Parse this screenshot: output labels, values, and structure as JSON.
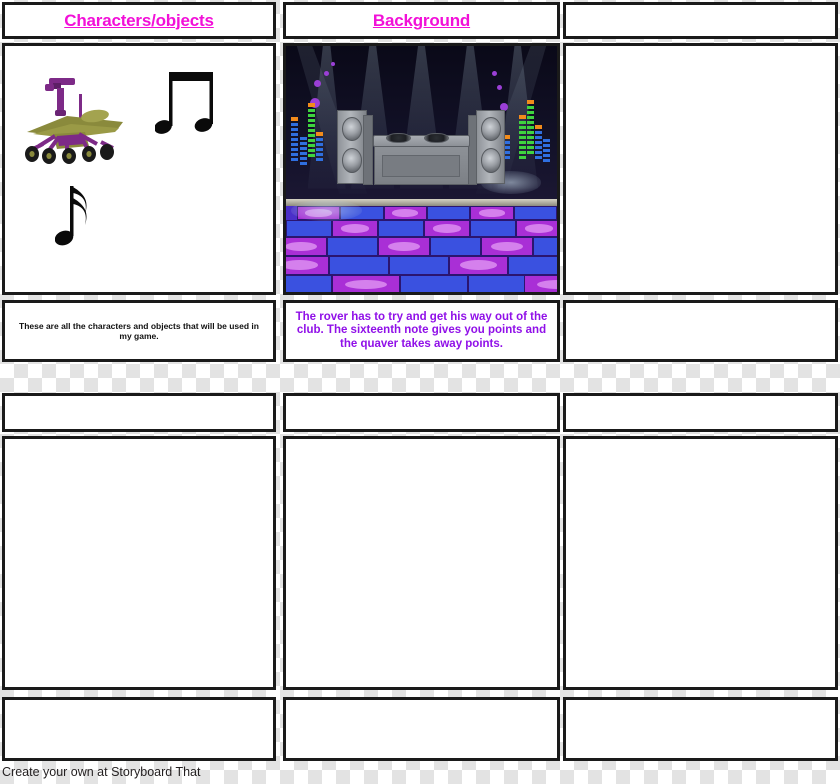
{
  "footer": {
    "text": "Create your own at Storyboard That"
  },
  "board": {
    "columns": 3,
    "rows": 2,
    "cells": [
      {
        "id": "r1c1",
        "title": "Characters/objects",
        "title_color": "#f210d8",
        "caption": "These are all the characters and objects that will be used in my game.",
        "caption_color": "#111111",
        "artwork": "characters-objects-scene",
        "has_art": true
      },
      {
        "id": "r1c2",
        "title": "Background",
        "title_color": "#f210d8",
        "caption": "The rover has to try and get his way out of the club. The sixteenth note gives you points and the quaver takes away points.",
        "caption_color": "#9010e8",
        "artwork": "nightclub-dancefloor-scene",
        "has_art": true
      },
      {
        "id": "r1c3",
        "title": "",
        "title_color": "#f210d8",
        "caption": "",
        "caption_color": "#111111",
        "artwork": "",
        "has_art": false
      },
      {
        "id": "r2c1",
        "title": "",
        "title_color": "#f210d8",
        "caption": "",
        "caption_color": "#111111",
        "artwork": "",
        "has_art": false
      },
      {
        "id": "r2c2",
        "title": "",
        "title_color": "#f210d8",
        "caption": "",
        "caption_color": "#111111",
        "artwork": "",
        "has_art": false
      },
      {
        "id": "r2c3",
        "title": "",
        "title_color": "#f210d8",
        "caption": "",
        "caption_color": "#111111",
        "artwork": "",
        "has_art": false
      }
    ]
  },
  "artwork": {
    "characters_objects": {
      "items": [
        {
          "name": "mars-rover",
          "colors": {
            "panel": "#8a8a3c",
            "body": "#7d2a87",
            "wheel": "#1a1a1a"
          }
        },
        {
          "name": "beamed-eighth-notes",
          "color": "#0a0a0a"
        },
        {
          "name": "sixteenth-note",
          "color": "#0a0a0a"
        }
      ]
    },
    "nightclub": {
      "elements": [
        "stage-lights",
        "equalizer-bars-left",
        "equalizer-bars-right",
        "left-speaker",
        "right-speaker",
        "dj-booth",
        "turntables",
        "disco-dots",
        "checkered-dance-floor"
      ],
      "colors": {
        "wall": "#0a0918",
        "floor_blue": "#3a51e0",
        "floor_magenta": "#a92fd6",
        "eq_blue": "#2f6fe0",
        "eq_green": "#3fd33f",
        "eq_cap": "#f28b1b",
        "speaker": "#9a9ea4",
        "dot": "#9b3fd6"
      }
    }
  }
}
